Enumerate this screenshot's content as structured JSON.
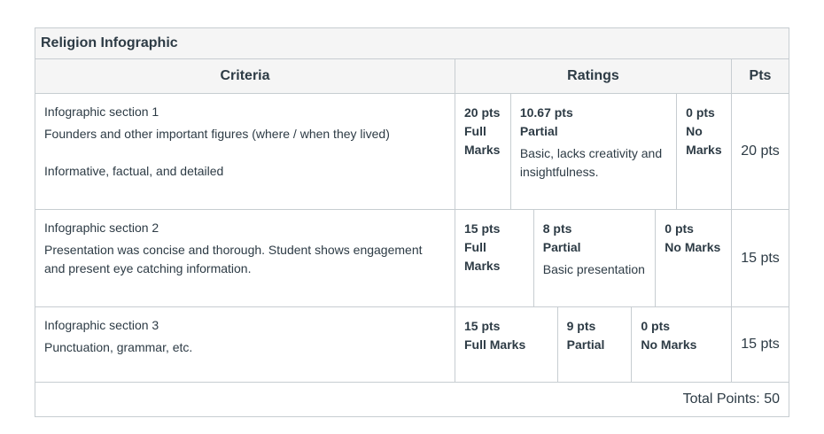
{
  "rubric": {
    "title": "Religion Infographic",
    "headers": {
      "criteria": "Criteria",
      "ratings": "Ratings",
      "pts": "Pts"
    },
    "rows": [
      {
        "description": "Infographic section 1",
        "long_description": "Founders and other important figures (where / when they lived)\n\nInformative, factual, and detailed",
        "ratings": [
          {
            "pts": "20 pts",
            "label": "Full Marks",
            "desc": ""
          },
          {
            "pts": "10.67 pts",
            "label": "Partial",
            "desc": "Basic, lacks creativity and insightfulness."
          },
          {
            "pts": "0 pts",
            "label": "No Marks",
            "desc": ""
          }
        ],
        "points": "20 pts"
      },
      {
        "description": "Infographic section 2",
        "long_description": "Presentation was concise and thorough. Student shows engagement and present eye catching information.",
        "ratings": [
          {
            "pts": "15 pts",
            "label": "Full Marks",
            "desc": ""
          },
          {
            "pts": "8 pts",
            "label": "Partial",
            "desc": "Basic presentation"
          },
          {
            "pts": "0 pts",
            "label": "No Marks",
            "desc": ""
          }
        ],
        "points": "15 pts"
      },
      {
        "description": "Infographic section 3",
        "long_description": "Punctuation, grammar, etc.",
        "ratings": [
          {
            "pts": "15 pts",
            "label": "Full Marks",
            "desc": ""
          },
          {
            "pts": "9 pts",
            "label": "Partial",
            "desc": ""
          },
          {
            "pts": "0 pts",
            "label": "No Marks",
            "desc": ""
          }
        ],
        "points": "15 pts"
      }
    ],
    "total": "Total Points: 50"
  }
}
